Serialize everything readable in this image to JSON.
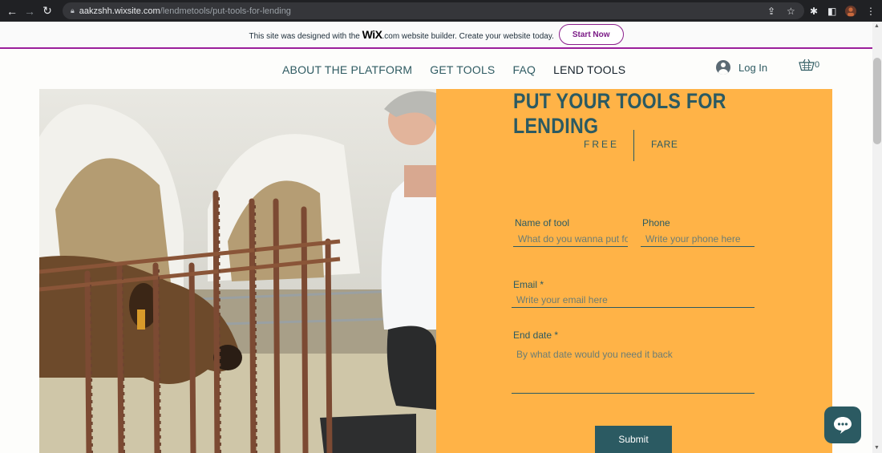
{
  "browser": {
    "url_host": "aakzshh.wixsite.com",
    "url_path": "/lendmetools/put-tools-for-lending"
  },
  "wix_banner": {
    "text_before": "This site was designed with the",
    "logo": "WiX",
    "text_after": ".com website builder. Create your website today.",
    "cta_label": "Start Now"
  },
  "header": {
    "menu": [
      {
        "label": "ABOUT THE PLATFORM"
      },
      {
        "label": "GET TOOLS"
      },
      {
        "label": "FAQ"
      },
      {
        "label": "LEND TOOLS"
      }
    ],
    "login_label": "Log In",
    "cart_count": "0"
  },
  "form": {
    "title": "PUT YOUR TOOLS FOR LENDING",
    "tabs": {
      "free": "FREE",
      "fare": "FARE"
    },
    "tool_name": {
      "label": "Name of tool",
      "placeholder": "What do you wanna put for lending"
    },
    "phone": {
      "label": "Phone",
      "placeholder": "Write your phone here"
    },
    "email": {
      "label": "Email *",
      "placeholder": "Write your email here"
    },
    "end_date": {
      "label": "End date *",
      "placeholder": "By what date would you need it back"
    },
    "submit_label": "Submit"
  },
  "colors": {
    "panel": "#ffb347",
    "accent": "#2b5a62",
    "wix_banner_border": "#9b1f9b"
  }
}
